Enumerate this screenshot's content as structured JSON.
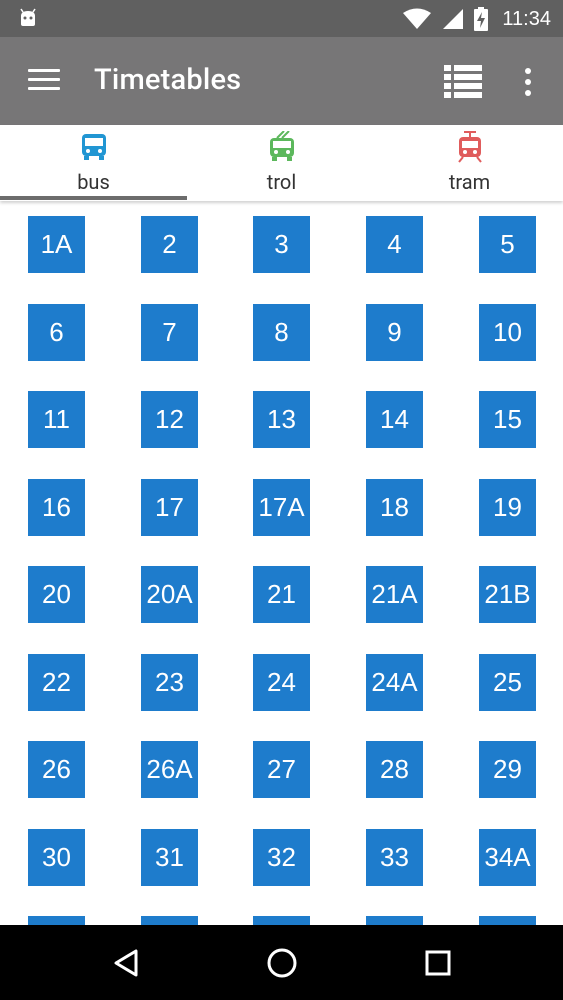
{
  "statusbar": {
    "time": "11:34",
    "icons": [
      "android-icon",
      "wifi-icon",
      "signal-icon",
      "battery-charging-icon"
    ]
  },
  "appbar": {
    "title": "Timetables",
    "menu_icon": "hamburger-menu-icon",
    "list_icon": "list-view-icon",
    "more_icon": "more-vert-icon"
  },
  "tabs": [
    {
      "label": "bus",
      "icon": "bus-icon",
      "color": "#2196d3",
      "selected": true
    },
    {
      "label": "trol",
      "icon": "trolleybus-icon",
      "color": "#5cb85c",
      "selected": false
    },
    {
      "label": "tram",
      "icon": "tram-icon",
      "color": "#e05c5c",
      "selected": false
    }
  ],
  "routes": [
    "1A",
    "2",
    "3",
    "4",
    "5",
    "6",
    "7",
    "8",
    "9",
    "10",
    "11",
    "12",
    "13",
    "14",
    "15",
    "16",
    "17",
    "17A",
    "18",
    "19",
    "20",
    "20A",
    "21",
    "21A",
    "21B",
    "22",
    "23",
    "24",
    "24A",
    "25",
    "26",
    "26A",
    "27",
    "28",
    "29",
    "30",
    "31",
    "32",
    "33",
    "34A",
    "",
    "",
    "",
    "",
    ""
  ],
  "colors": {
    "route_tile": "#1e7ccc",
    "appbar": "#777677",
    "statusbar": "#606060"
  },
  "navbar": {
    "back_icon": "back-triangle-icon",
    "home_icon": "home-circle-icon",
    "recents_icon": "recents-square-icon"
  }
}
